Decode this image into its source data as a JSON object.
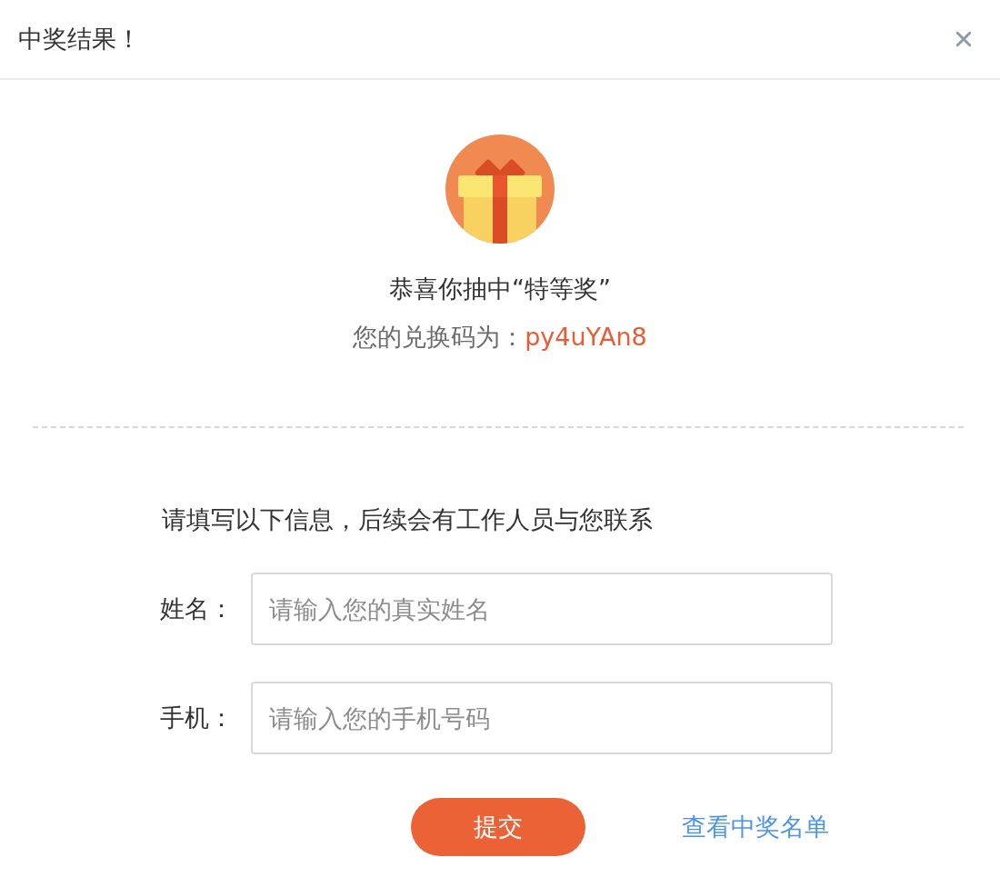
{
  "dialog": {
    "title": "中奖结果！"
  },
  "prize": {
    "message": "恭喜你抽中“特等奖”",
    "code_label": "您的兑换码为：",
    "code": "py4uYAn8"
  },
  "form": {
    "intro": "请填写以下信息，后续会有工作人员与您联系",
    "fields": [
      {
        "label": "姓名：",
        "placeholder": "请输入您的真实姓名"
      },
      {
        "label": "手机：",
        "placeholder": "请输入您的手机号码"
      }
    ],
    "submit": "提交",
    "link": "查看中奖名单"
  }
}
